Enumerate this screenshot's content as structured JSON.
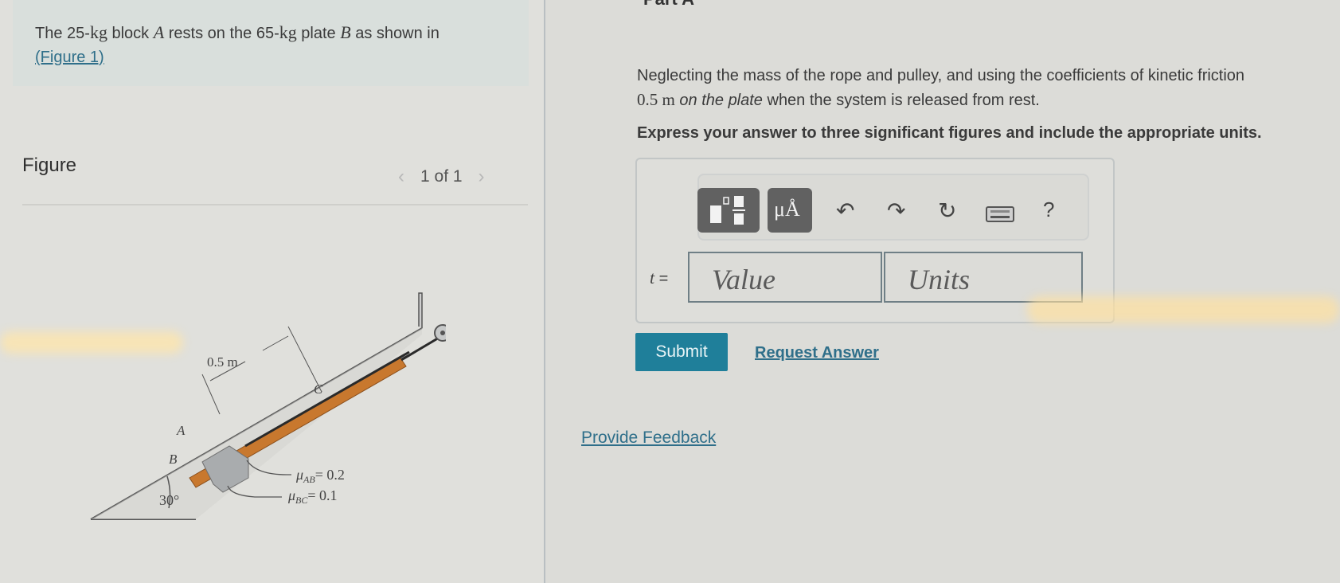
{
  "intro": {
    "text_before_a": "The 25-",
    "unit_kg1": "kg",
    "text_block": " block ",
    "var_a": "A",
    "text_rests": " rests on the 65-",
    "unit_kg2": "kg",
    "text_plate": " plate ",
    "var_b": "B",
    "text_shown": " as shown in",
    "figure_link": "(Figure 1)"
  },
  "figure_panel": {
    "label": "Figure",
    "pager_text": "1 of 1",
    "prev_icon": "chevron-left-icon",
    "next_icon": "chevron-right-icon",
    "diagram": {
      "dimension_label": "0.5 m",
      "label_a": "A",
      "label_b": "B",
      "label_c": "C",
      "mu_ab": "μ",
      "mu_ab_sub": "AB",
      "mu_ab_value": "= 0.2",
      "mu_bc": "μ",
      "mu_bc_sub": "BC",
      "mu_bc_value": "= 0.1",
      "angle_label": "30°",
      "colors": {
        "plate": "#c8782e",
        "block": "#a9acae",
        "rope": "#2a2a2a"
      }
    }
  },
  "part": {
    "title": "Part A",
    "question_line1": "Neglecting the mass of the rope and pulley, and using the coefficients of kinetic friction",
    "question_line2_value": "0.5 m",
    "question_line2_italic": " on the plate",
    "question_line2_rest": " when the system is released from rest.",
    "instruction": "Express your answer to three significant figures and include the appropriate units."
  },
  "answer": {
    "toolbar": {
      "template_icon": "fraction-template-icon",
      "units_button_label": "μÅ",
      "undo_icon": "undo-icon",
      "redo_icon": "redo-icon",
      "reset_icon": "reset-icon",
      "keyboard_icon": "keyboard-icon",
      "help_label": "?"
    },
    "variable": "t",
    "equals": " =",
    "value_placeholder": "Value",
    "units_placeholder": "Units",
    "value": "",
    "units": ""
  },
  "actions": {
    "submit_label": "Submit",
    "request_answer_label": "Request Answer",
    "feedback_label": "Provide Feedback"
  },
  "colors": {
    "accent": "#1f7f9a",
    "link": "#2f6f8a",
    "toolbar_button": "#616161"
  }
}
